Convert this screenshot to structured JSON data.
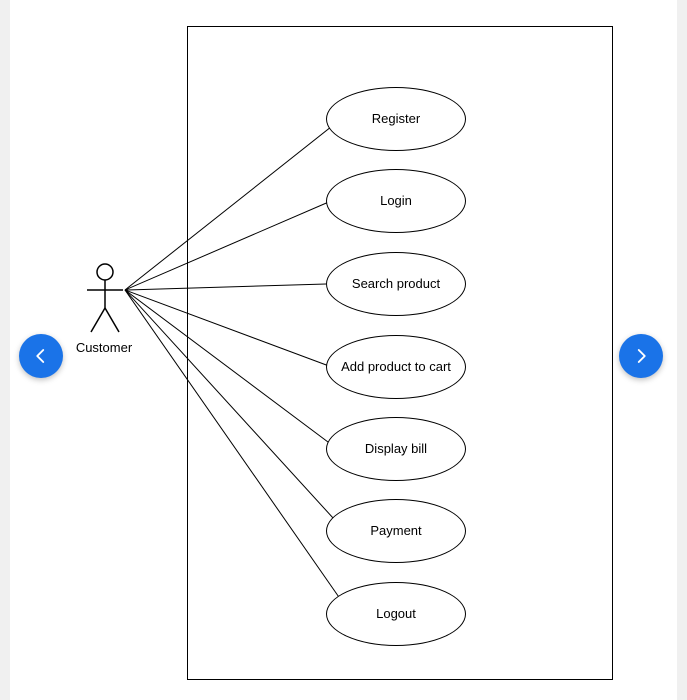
{
  "diagram": {
    "actor": {
      "label": "Customer"
    },
    "usecases": [
      {
        "label": "Register"
      },
      {
        "label": "Login"
      },
      {
        "label": "Search product"
      },
      {
        "label": "Add product to cart"
      },
      {
        "label": "Display bill"
      },
      {
        "label": "Payment"
      },
      {
        "label": "Logout"
      }
    ]
  },
  "nav": {
    "prev_aria": "Previous",
    "next_aria": "Next"
  },
  "colors": {
    "accent": "#1a73e8",
    "border": "#000000",
    "page_bg": "#ffffff",
    "outer_bg": "#f0f0f0"
  }
}
